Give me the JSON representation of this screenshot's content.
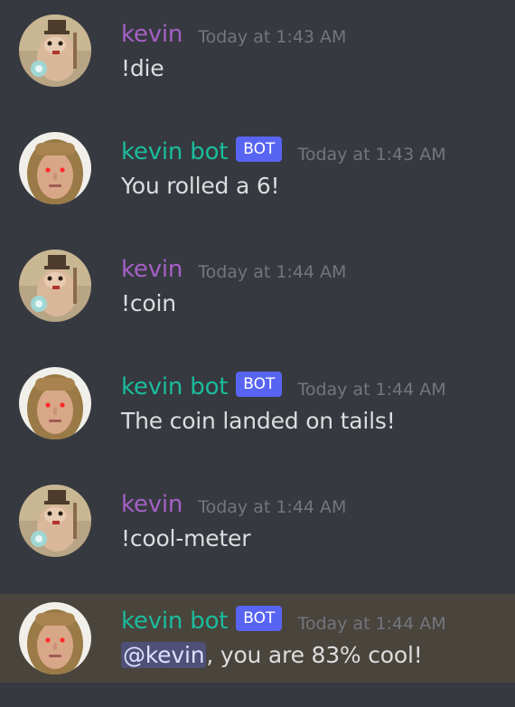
{
  "colors": {
    "background": "#36393f",
    "mention_highlight": "#49443c",
    "user_name_color": "#a560c6",
    "bot_name_color": "#1abc9c",
    "bot_tag_color": "#5865f2",
    "timestamp_color": "#72767d",
    "message_text_color": "#dcddde"
  },
  "messages": [
    {
      "author": "kevin",
      "is_bot": false,
      "timestamp": "Today at 1:43 AM",
      "text": "!die",
      "avatar_icon": "hamster-avatar-icon"
    },
    {
      "author": "kevin bot",
      "is_bot": true,
      "bot_tag": "BOT",
      "timestamp": "Today at 1:43 AM",
      "text": "You rolled a 6!",
      "avatar_icon": "face-avatar-icon"
    },
    {
      "author": "kevin",
      "is_bot": false,
      "timestamp": "Today at 1:44 AM",
      "text": "!coin",
      "avatar_icon": "hamster-avatar-icon"
    },
    {
      "author": "kevin bot",
      "is_bot": true,
      "bot_tag": "BOT",
      "timestamp": "Today at 1:44 AM",
      "text": "The coin landed on tails!",
      "avatar_icon": "face-avatar-icon"
    },
    {
      "author": "kevin",
      "is_bot": false,
      "timestamp": "Today at 1:44 AM",
      "text": "!cool-meter",
      "avatar_icon": "hamster-avatar-icon"
    },
    {
      "author": "kevin bot",
      "is_bot": true,
      "bot_tag": "BOT",
      "timestamp": "Today at 1:44 AM",
      "mention": "@kevin",
      "text": ", you are 83% cool!",
      "avatar_icon": "face-avatar-icon",
      "highlighted": true
    }
  ]
}
